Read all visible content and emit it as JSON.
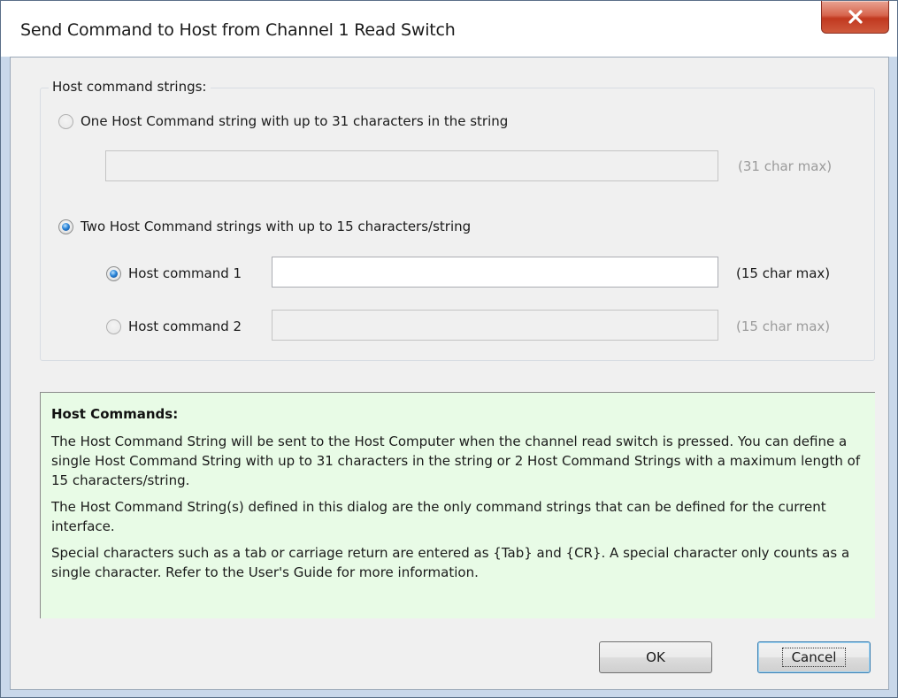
{
  "window": {
    "title": "Send Command to Host from Channel 1 Read Switch"
  },
  "group": {
    "label": "Host command strings:",
    "option_one": {
      "label": "One Host Command string with up to 31 characters in the string",
      "checked": false,
      "input_value": "",
      "hint": "(31 char max)"
    },
    "option_two": {
      "label": "Two Host Command strings with up to 15 characters/string",
      "checked": true,
      "command1": {
        "label": "Host command 1",
        "checked": true,
        "input_value": "",
        "hint": "(15 char max)"
      },
      "command2": {
        "label": "Host command 2",
        "checked": false,
        "input_value": "",
        "hint": "(15 char max)"
      }
    }
  },
  "help": {
    "title": "Host Commands:",
    "paragraphs": [
      "The Host Command String will be sent to the Host Computer when the channel read switch is pressed. You can define a single Host Command String with up to 31 characters in the string or 2 Host Command Strings with a maximum length of 15 characters/string.",
      "The Host Command String(s) defined in this dialog are the only command strings that can be defined for the current interface.",
      "Special characters such as a tab or carriage return are entered as {Tab} and {CR}.  A special character only counts as a single character.  Refer to the User's Guide for more information."
    ]
  },
  "buttons": {
    "ok_label": "OK",
    "cancel_label": "Cancel"
  },
  "icons": {
    "close": "close-icon"
  },
  "colors": {
    "help_background": "#e8fbe6",
    "close_button": "#c94a30",
    "radio_selected": "#2a85d8"
  }
}
